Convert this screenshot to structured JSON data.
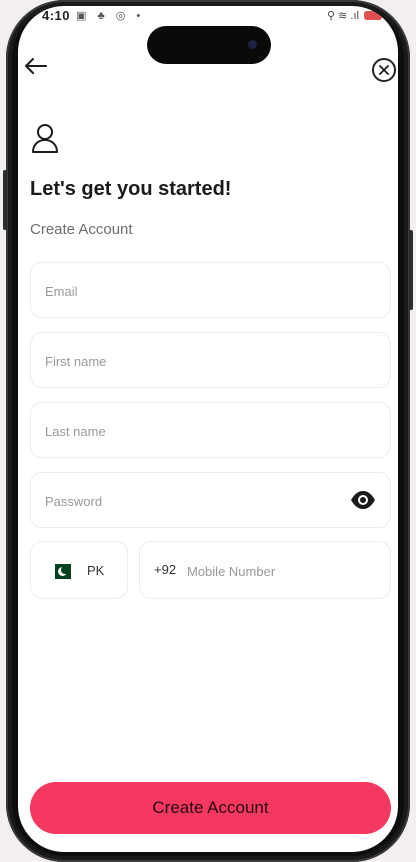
{
  "status_bar": {
    "time": "4:10",
    "left_icons": "▣ ♣ ◎ •",
    "right_icons": "⚲ ≋ .ıl"
  },
  "header": {
    "back_icon": "arrow-left-icon",
    "close_icon": "close-circle-icon"
  },
  "page": {
    "title": "Let's get you started!",
    "subtitle": "Create Account"
  },
  "form": {
    "email_placeholder": "Email",
    "first_name_placeholder": "First name",
    "last_name_placeholder": "Last name",
    "password_placeholder": "Password",
    "country_code": "PK",
    "dial_code": "+92",
    "mobile_placeholder": "Mobile Number"
  },
  "actions": {
    "create_account_label": "Create Account"
  },
  "colors": {
    "accent": "#f4385f",
    "flag_green": "#01411c"
  }
}
